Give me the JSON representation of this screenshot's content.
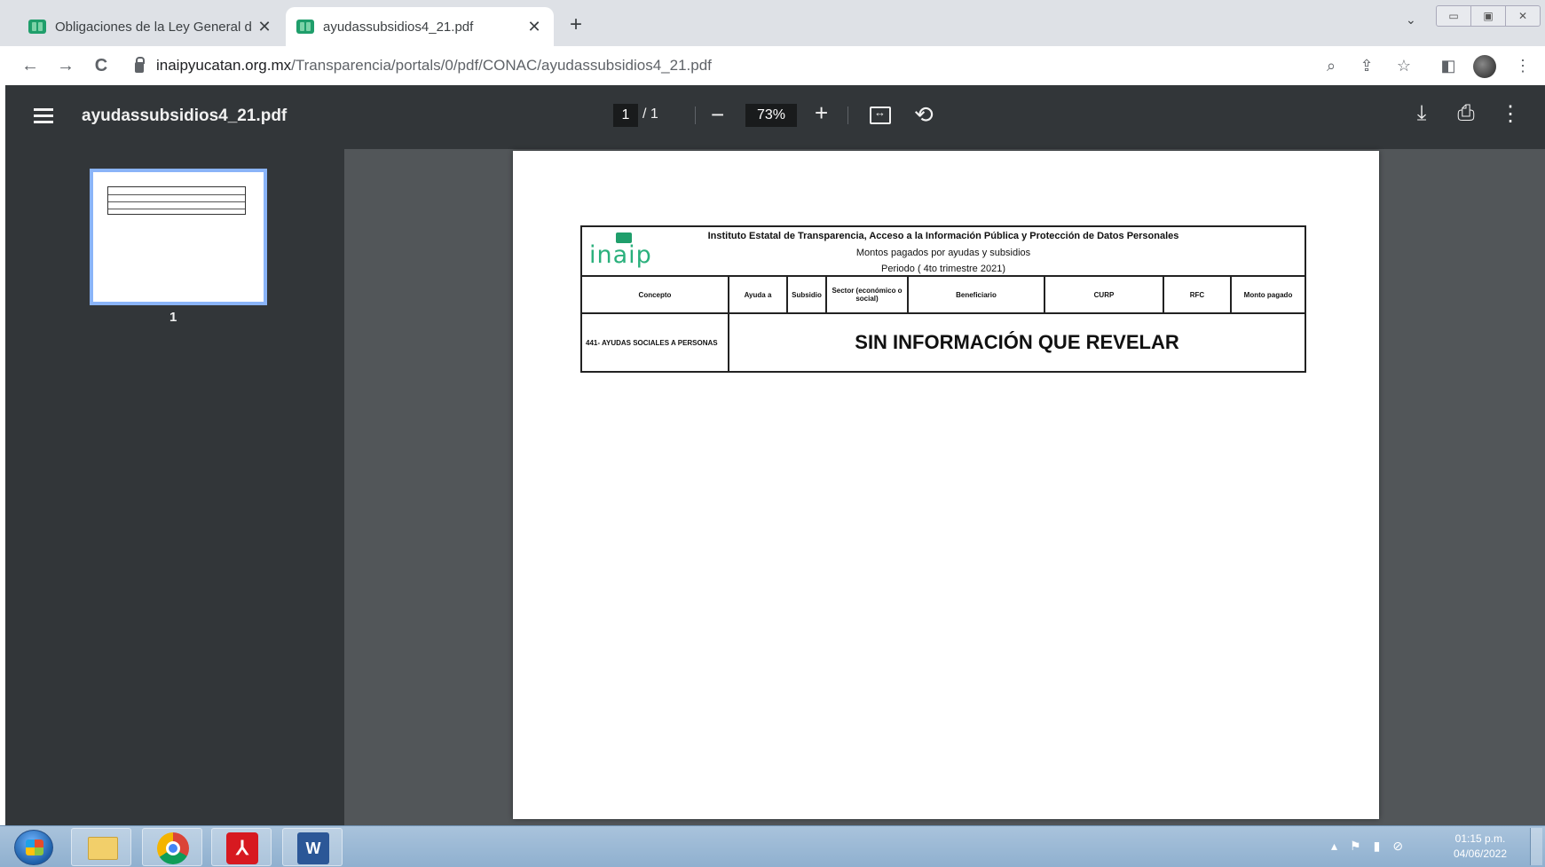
{
  "browser": {
    "tabs": [
      {
        "title": "Obligaciones de la Ley General d",
        "close": "✕",
        "active": false
      },
      {
        "title": "ayudassubsidios4_21.pdf",
        "close": "✕",
        "active": true
      }
    ],
    "new_tab": "+",
    "tab_search": "⌄",
    "window_controls": [
      "▭",
      "▣",
      "✕"
    ],
    "nav": {
      "back": "←",
      "forward": "→",
      "reload": "C"
    },
    "url": {
      "host": "inaipyucatan.org.mx",
      "path": "/Transparencia/portals/0/pdf/CONAC/ayudassubsidios4_21.pdf"
    },
    "toolbar_icons": {
      "zoom": "⌕",
      "share": "⇪",
      "bookmark": "☆",
      "sidebar": "◧",
      "menu": "⋮"
    }
  },
  "pdf_viewer": {
    "title": "ayudassubsidios4_21.pdf",
    "current_page": "1",
    "page_sep": "/ 1",
    "zoom": "73%",
    "zoom_out": "−",
    "zoom_in": "+",
    "rotate": "⟲",
    "download": "⤓",
    "print": "⎙",
    "more": "⋮",
    "thumbnail_label": "1"
  },
  "document": {
    "logo_text": "inaip",
    "header_lines": [
      "Instituto Estatal de Transparencia, Acceso a la Información Pública y Protección de Datos Personales",
      "Montos pagados por ayudas y subsidios",
      "Periodo ( 4to trimestre 2021)"
    ],
    "columns": [
      "Concepto",
      "Ayuda a",
      "Subsidio",
      "Sector (económico o social)",
      "Beneficiario",
      "CURP",
      "RFC",
      "Monto pagado"
    ],
    "row_concept": "441- AYUDAS SOCIALES A PERSONAS",
    "row_message": "SIN INFORMACIÓN QUE REVELAR"
  },
  "taskbar": {
    "tray_icons": [
      "▴",
      "⚑",
      "▮",
      "⊘"
    ],
    "time": "01:15 p.m.",
    "date": "04/06/2022"
  },
  "colors": {
    "tabstrip": "#dee1e6",
    "pdf_toolbar": "#323639",
    "viewer_bg": "#525659",
    "thumb_border": "#8ab4f8",
    "inaip_green": "#2ab07c",
    "taskbar": "#a9c3dc"
  }
}
